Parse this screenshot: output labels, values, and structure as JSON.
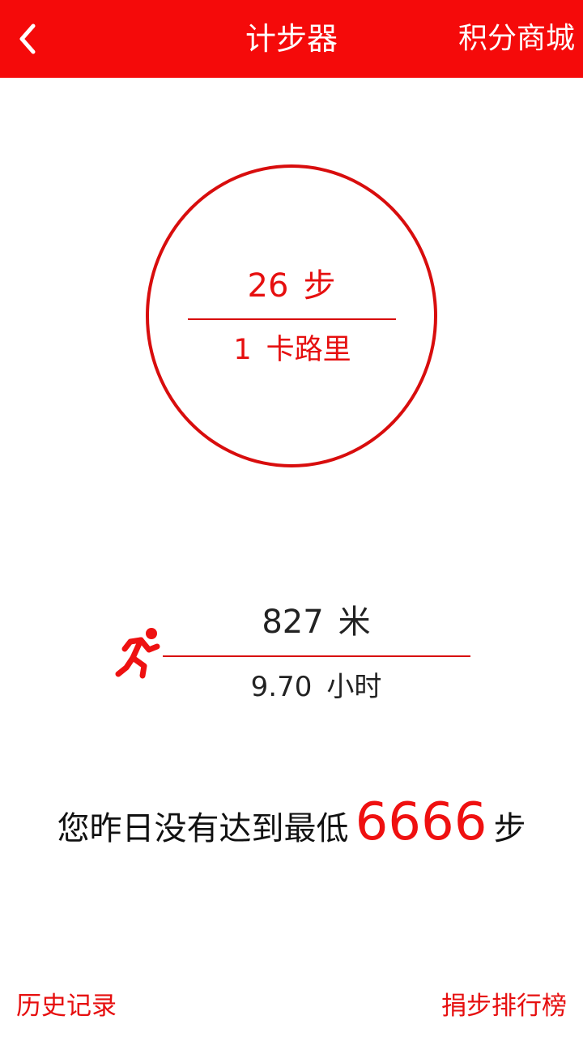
{
  "colors": {
    "accent": "#f50a0a",
    "ring": "#d80d0d",
    "header_text": "#ffffff",
    "body_text": "#222222"
  },
  "header": {
    "back_icon": "chevron-left-icon",
    "title": "计步器",
    "right_link": "积分商城"
  },
  "ring": {
    "steps_value": "26",
    "steps_unit": "步",
    "calories_value": "1",
    "calories_unit": "卡路里"
  },
  "activity": {
    "icon": "runner-icon",
    "distance_value": "827",
    "distance_unit": "米",
    "duration_value": "9.70",
    "duration_unit": "小时"
  },
  "goal": {
    "prefix": "您昨日没有达到最低",
    "number": "6666",
    "suffix": "步"
  },
  "footer": {
    "history": "历史记录",
    "ranking": "捐步排行榜"
  }
}
